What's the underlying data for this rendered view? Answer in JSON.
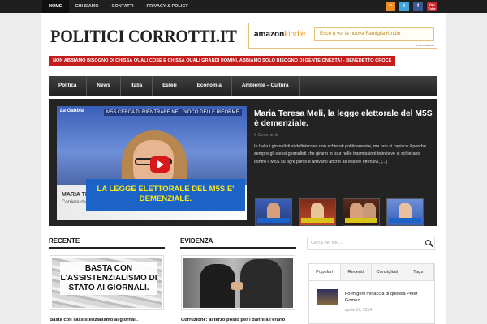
{
  "topnav": [
    "HOME",
    "CHI SIAMO",
    "CONTATTI",
    "PRIVACY & POLICY"
  ],
  "social": [
    {
      "name": "rss-icon",
      "color": "#f28a22",
      "glyph": ")"
    },
    {
      "name": "twitter-icon",
      "color": "#3fa4d9",
      "glyph": "t"
    },
    {
      "name": "facebook-icon",
      "color": "#3b5998",
      "glyph": "f"
    },
    {
      "name": "youtube-icon",
      "color": "#c9242a",
      "glyph": "You\nTube"
    }
  ],
  "site": {
    "logo": "POLITICI CORROTTI.IT",
    "tagline": "NON ABBIAMO BISOGNO DI CHISSÀ QUALI COSE E CHISSÀ QUALI GRANDI UOMINI. ABBIAMO SOLO BISOGNO DI GENTE ONESTA! - BENEDETTO CROCE"
  },
  "ad": {
    "brand": "amazon",
    "brand_suffix": "kindle",
    "text": "Ecco a voi la nuova Famiglia Kindle",
    "info": "Informazioni"
  },
  "mainnav": [
    "Politica",
    "News",
    "Italia",
    "Esteri",
    "Economia",
    "Ambiente – Cultura"
  ],
  "featured": {
    "video_brand": "La Gabbia",
    "video_headline": "M5S CERCA DI RIENTRARE NEL GIOCO DELLE RIFORME",
    "video_name": "MARIA TERESA MELI",
    "video_sub": "Corriere della Sera",
    "video_banner": "LA LEGGE ELETTORALE DEL M5S E' DEMENZIALE.",
    "title": "Maria Teresa Meli, la legge elettorale del M5S è demenziale.",
    "comments": "6 Commenti",
    "excerpt": "In Italia i giornalisti si definiscono non schierati politicamente, ma non si capisce il perché sempre gli stessi giornalisti che girano in tour nelle trasmissioni televisive si schierano contro il M5S su ogni punto e arrivano anche ad essere offensivi, [...]"
  },
  "sections": {
    "recente": "RECENTE",
    "evidenza": "EVIDENZA",
    "recente_img_text": "BASTA CON L'ASSISTENZIALISMO DI STATO AI GIORNALI.",
    "recente_caption": "Basta con l'assistenzialismo ai giornali.",
    "evidenza_caption": "Corruzione: al terzo posto per i danni all'erario"
  },
  "sidebar": {
    "search_placeholder": "Cerca nel sito...",
    "tabs": [
      "Popolari",
      "Recenti",
      "Consigliati",
      "Tags"
    ],
    "post_title": "Formigoni minaccia di querela Peter Gomez.",
    "post_date": "aprile 17, 2014"
  }
}
